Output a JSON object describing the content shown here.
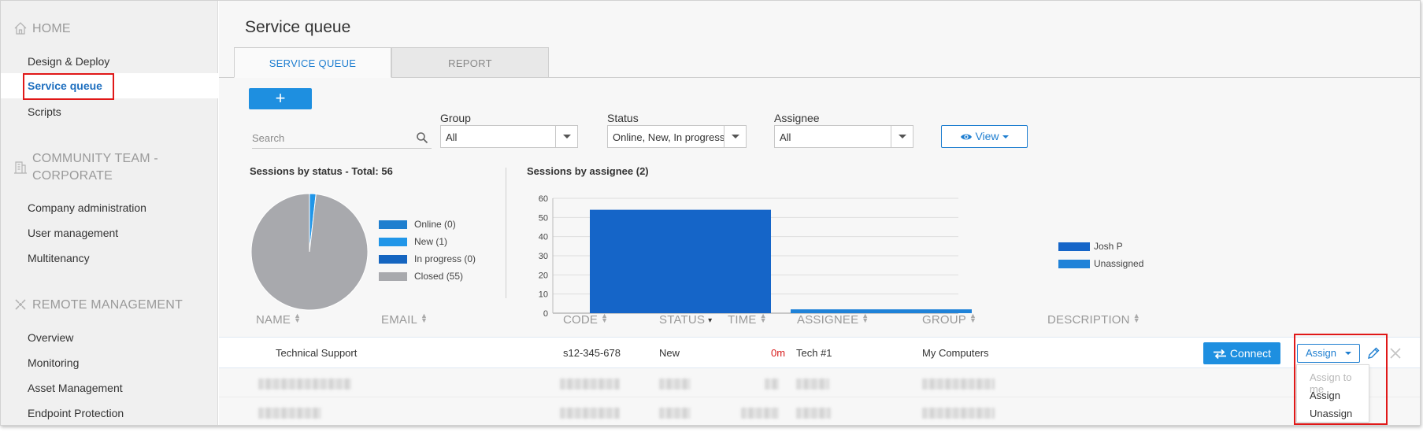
{
  "sidebar": {
    "sections": [
      {
        "title": "HOME",
        "icon": "home-icon",
        "items": [
          "Design & Deploy",
          "Service queue",
          "Scripts"
        ],
        "active": "Service queue"
      },
      {
        "title": "COMMUNITY TEAM - CORPORATE",
        "title_line1": "COMMUNITY TEAM -",
        "title_line2": "CORPORATE",
        "icon": "building-icon",
        "items": [
          "Company administration",
          "User management",
          "Multitenancy"
        ]
      },
      {
        "title": "REMOTE MANAGEMENT",
        "icon": "remote-icon",
        "items": [
          "Overview",
          "Monitoring",
          "Asset Management",
          "Endpoint Protection"
        ]
      }
    ]
  },
  "main": {
    "title": "Service queue",
    "tabs": [
      {
        "label": "SERVICE QUEUE",
        "active": true
      },
      {
        "label": "REPORT",
        "active": false
      }
    ],
    "add_label": "+",
    "search": {
      "placeholder": "Search",
      "value": ""
    },
    "filters": {
      "group": {
        "label": "Group",
        "value": "All"
      },
      "status": {
        "label": "Status",
        "value": "Online, New, In progress, Clo"
      },
      "assignee": {
        "label": "Assignee",
        "value": "All"
      }
    },
    "view_label": "View",
    "status_chart": {
      "title": "Sessions by status - Total: 56",
      "legend": [
        "Online (0)",
        "New (1)",
        "In progress (0)",
        "Closed (55)"
      ]
    },
    "assignee_chart": {
      "title": "Sessions by assignee (2)",
      "legend": [
        "Josh P",
        "Unassigned"
      ],
      "yticks": [
        "0",
        "10",
        "20",
        "30",
        "40",
        "50",
        "60"
      ]
    },
    "columns": [
      {
        "label": "NAME"
      },
      {
        "label": "EMAIL"
      },
      {
        "label": "CODE"
      },
      {
        "label": "STATUS"
      },
      {
        "label": "TIME"
      },
      {
        "label": "ASSIGNEE"
      },
      {
        "label": "GROUP"
      },
      {
        "label": "DESCRIPTION"
      }
    ],
    "rows": [
      {
        "name": "Technical Support",
        "email": "",
        "code": "s12-345-678",
        "status": "New",
        "time": "0m",
        "assignee": "Tech #1",
        "group": "My Computers",
        "description": ""
      }
    ],
    "row_actions": {
      "connect": "Connect",
      "assign": "Assign"
    },
    "assign_menu": [
      {
        "label": "Assign to me",
        "disabled": true
      },
      {
        "label": "Assign",
        "disabled": false
      },
      {
        "label": "Unassign",
        "disabled": false
      }
    ]
  },
  "colors": {
    "accent": "#1e8fe0",
    "link": "#1e7ed0",
    "highlight_box": "#e01818",
    "closed": "#a8a9ad",
    "online": "#1f7fcf",
    "new": "#2196e8",
    "in_progress": "#1565c0",
    "josh_p": "#1565c8",
    "unassigned": "#1f82d8",
    "time_red": "#d81b1b"
  },
  "chart_data": [
    {
      "type": "pie",
      "title": "Sessions by status - Total: 56",
      "categories": [
        "Online (0)",
        "New (1)",
        "In progress (0)",
        "Closed (55)"
      ],
      "values": [
        0,
        1,
        0,
        55
      ],
      "legend": "right"
    },
    {
      "type": "bar",
      "title": "Sessions by assignee (2)",
      "categories": [
        "Josh P",
        "Unassigned"
      ],
      "values": [
        54,
        2
      ],
      "ylim": [
        0,
        60
      ],
      "yticks": [
        0,
        10,
        20,
        30,
        40,
        50,
        60
      ],
      "grid": true,
      "legend": "right"
    }
  ]
}
